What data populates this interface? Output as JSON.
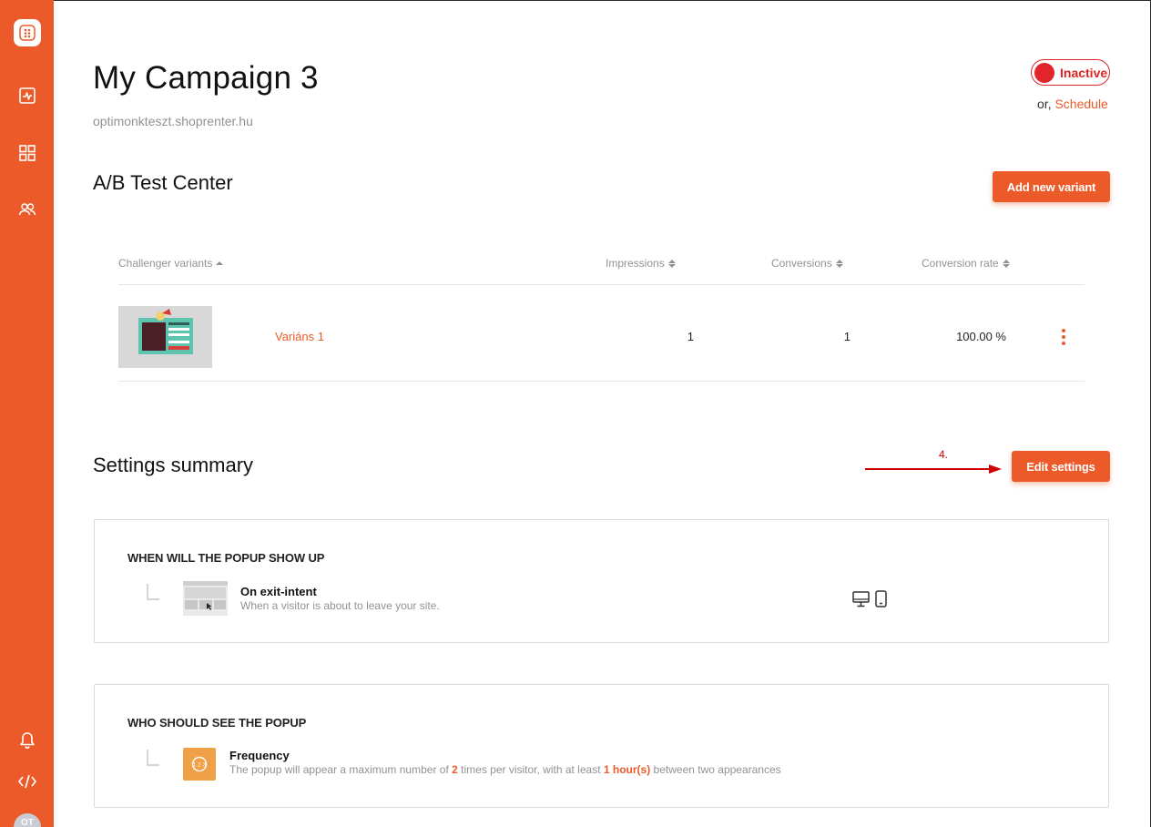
{
  "sidebar": {
    "logo_icon": "optimonk-logo-icon",
    "items": [
      {
        "icon": "analytics-icon"
      },
      {
        "icon": "dashboard-grid-icon"
      },
      {
        "icon": "users-icon"
      }
    ],
    "bottom": [
      {
        "icon": "bell-icon"
      },
      {
        "icon": "code-icon"
      }
    ],
    "avatar_initials": "OT"
  },
  "header": {
    "title": "My Campaign 3",
    "domain": "optimonkteszt.shoprenter.hu",
    "status_label": "Inactive",
    "schedule_prefix": "or,",
    "schedule_link": "Schedule"
  },
  "ab_test": {
    "title": "A/B Test Center",
    "add_button": "Add new variant",
    "columns": {
      "variants": "Challenger variants",
      "impressions": "Impressions",
      "conversions": "Conversions",
      "rate": "Conversion rate"
    },
    "rows": [
      {
        "name": "Variáns 1",
        "impressions": "1",
        "conversions": "1",
        "rate": "100.00 %"
      }
    ]
  },
  "annotation": {
    "label": "4."
  },
  "settings": {
    "title": "Settings summary",
    "edit_button": "Edit settings",
    "when": {
      "title": "WHEN WILL THE POPUP SHOW UP",
      "rule_name": "On exit-intent",
      "rule_desc": "When a visitor is about to leave your site.",
      "device_icons": [
        "desktop-icon",
        "mobile-icon"
      ]
    },
    "who": {
      "title": "WHO SHOULD SEE THE POPUP",
      "rule_name": "Frequency",
      "desc_1": "The popup will appear a maximum number of ",
      "value_times": "2",
      "desc_2": " times per visitor, with at least ",
      "value_interval": "1 hour(s)",
      "desc_3": " between two appearances"
    }
  },
  "colors": {
    "brand": "#ed5a29",
    "inactive": "#e02424",
    "frequency_icon_bg": "#f0a046"
  }
}
